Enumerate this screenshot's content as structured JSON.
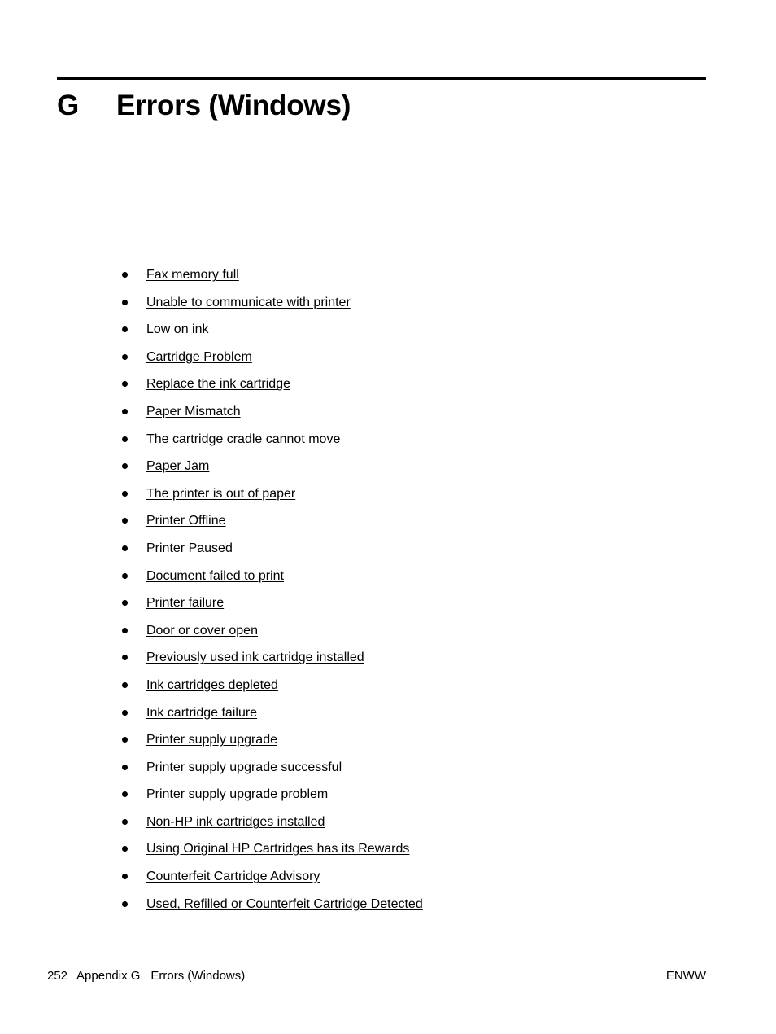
{
  "document": {
    "page_number": "252",
    "language_code": "ENWW"
  },
  "chapter": {
    "letter": "G",
    "title": "Errors (Windows)",
    "rule_color": "#000000"
  },
  "links": [
    {
      "label": "Fax memory full"
    },
    {
      "label": "Unable to communicate with printer"
    },
    {
      "label": "Low on ink"
    },
    {
      "label": "Cartridge Problem"
    },
    {
      "label": "Replace the ink cartridge"
    },
    {
      "label": "Paper Mismatch"
    },
    {
      "label": "The cartridge cradle cannot move"
    },
    {
      "label": "Paper Jam"
    },
    {
      "label": "The printer is out of paper"
    },
    {
      "label": "Printer Offline"
    },
    {
      "label": "Printer Paused"
    },
    {
      "label": "Document failed to print"
    },
    {
      "label": "Printer failure"
    },
    {
      "label": "Door or cover open"
    },
    {
      "label": "Previously used ink cartridge installed"
    },
    {
      "label": "Ink cartridges depleted"
    },
    {
      "label": "Ink cartridge failure"
    },
    {
      "label": "Printer supply upgrade"
    },
    {
      "label": "Printer supply upgrade successful"
    },
    {
      "label": "Printer supply upgrade problem"
    },
    {
      "label": "Non-HP ink cartridges installed"
    },
    {
      "label": "Using Original HP Cartridges has its Rewards"
    },
    {
      "label": "Counterfeit Cartridge Advisory"
    },
    {
      "label": "Used, Refilled or Counterfeit Cartridge Detected"
    }
  ],
  "footer": {
    "page_number": "252",
    "appendix_label": "Appendix G",
    "chapter_title": "Errors (Windows)",
    "right_label": "ENWW"
  }
}
